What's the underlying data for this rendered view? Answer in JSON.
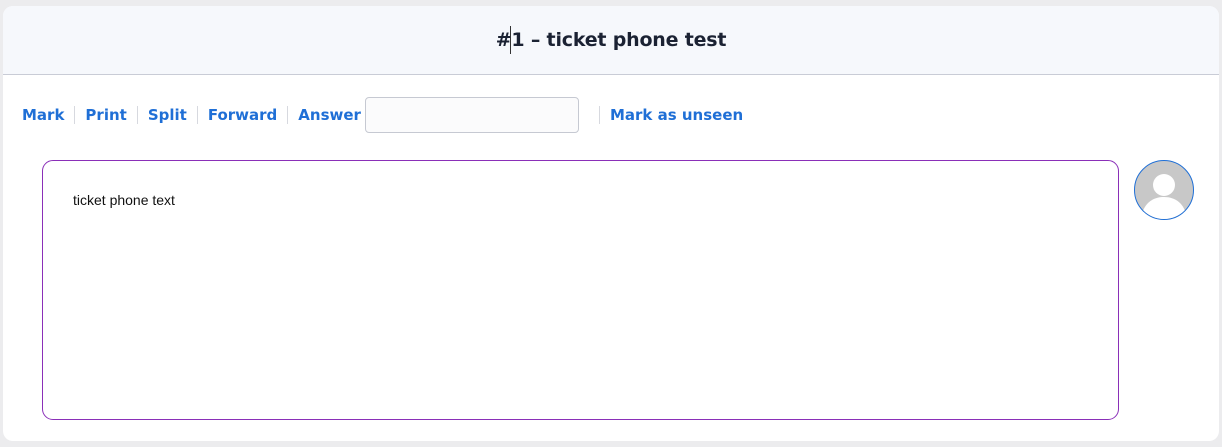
{
  "ticket": {
    "title": "#1 – ticket phone test"
  },
  "toolbar": {
    "mark_label": "Mark",
    "print_label": "Print",
    "split_label": "Split",
    "forward_label": "Forward",
    "answer_label": "Answer",
    "answer_value": "",
    "mark_unseen_label": "Mark as unseen"
  },
  "message": {
    "body": "ticket phone text"
  },
  "colors": {
    "link": "#1f6fd6",
    "message_border": "#8a2fb8",
    "header_bg": "#f6f8fc"
  },
  "icons": {
    "avatar": "user-avatar-icon"
  }
}
